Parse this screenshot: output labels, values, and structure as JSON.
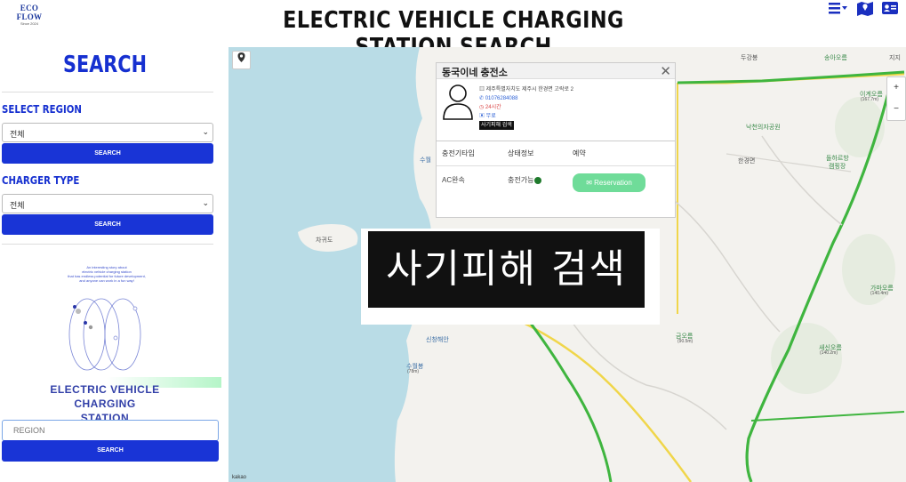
{
  "header": {
    "logo_name": "ECO FLOW",
    "logo_since": "Since 2024",
    "title": "ELECTRIC VEHICLE CHARGING STATION SEARCH",
    "icons": [
      "menu-icon",
      "map-icon",
      "profile-card-icon"
    ]
  },
  "sidebar": {
    "title": "SEARCH",
    "region_label": "SELECT REGION",
    "region_value": "전체",
    "region_button": "SEARCH",
    "charger_label": "CHARGER TYPE",
    "charger_value": "전체",
    "charger_button": "SEARCH",
    "promo_lines": [
      "An interesting story about",
      "electric vehicle charging station",
      "that has endless potential for future development,",
      "and anyone can work in a fun way!"
    ],
    "promo_caption_1": "ELECTRIC VEHICLE CHARGING",
    "promo_caption_2": "STATION",
    "region_input_placeholder": "REGION",
    "region_input_button": "SEARCH"
  },
  "map": {
    "labels": {
      "dugangbong": "두강봉",
      "songaoreum": "송아오름",
      "jiji": "지지",
      "igyeseoreum": "이계오름",
      "igyeseoreum_elev": "(167.7m)",
      "ga": "가",
      "nakcheon": "낙천의자공원",
      "hangyeongmyeon": "한경면",
      "dolbandeul": "돌하르방",
      "dolbandeul2": "캠핑장",
      "suwol": "수월",
      "chagwido": "차귀도",
      "gamaoreum": "가마오름",
      "gamaoreum_elev": "(140.4m)",
      "geumoreum": "금오름",
      "geumoreum_elev": "(90.5m)",
      "saesinoreum": "새신오름",
      "saesinoreum_elev": "(140.2m)",
      "sinchanghaean": "신창해안",
      "sujeongbong": "수월봉",
      "sujeongbong_elev": "(78m)",
      "scale": "kakao"
    },
    "zoom_in": "+",
    "zoom_out": "−"
  },
  "popup": {
    "station_name": "동국이네 충전소",
    "address": "제주특별자치도 제주시 한경면 고락로 2",
    "phone": "01076284088",
    "hours": "24시간",
    "fee": "무료",
    "fraud_button": "사기피해 검색",
    "col_charger": "충전기타입",
    "col_status": "상태정보",
    "col_reserve": "예약",
    "row_type": "AC완속",
    "row_status": "충전가능",
    "reserve_button": "Reservation"
  },
  "overlay": {
    "text": "사기피해 검색"
  }
}
